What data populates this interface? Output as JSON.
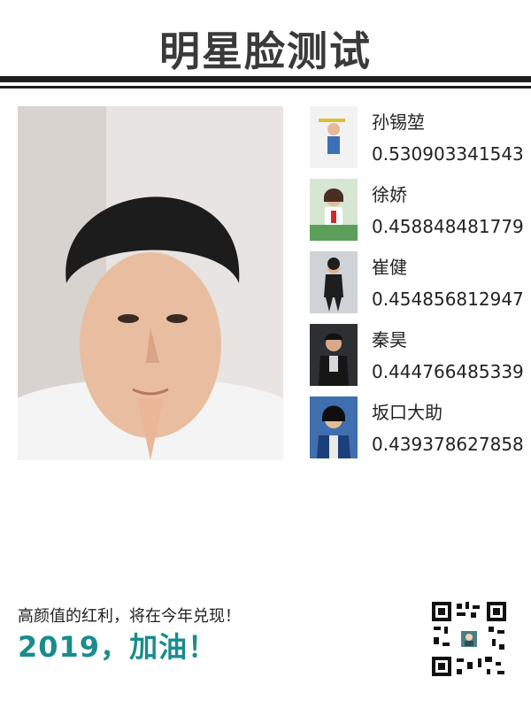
{
  "header": {
    "title": "明星脸测试"
  },
  "main_photo": {
    "description_icon": "portrait-photo"
  },
  "matches": [
    {
      "name": "孙锡堃",
      "score": "0.530903341543"
    },
    {
      "name": "徐娇",
      "score": "0.458848481779"
    },
    {
      "name": "崔健",
      "score": "0.454856812947"
    },
    {
      "name": "秦昊",
      "score": "0.444766485339"
    },
    {
      "name": "坂口大助",
      "score": "0.439378627858"
    }
  ],
  "footer": {
    "line1": "高颜值的红利，将在今年兑现！",
    "line2": "2019，加油！"
  },
  "colors": {
    "accent": "#1a8c8c",
    "rule": "#1f1f1f"
  }
}
